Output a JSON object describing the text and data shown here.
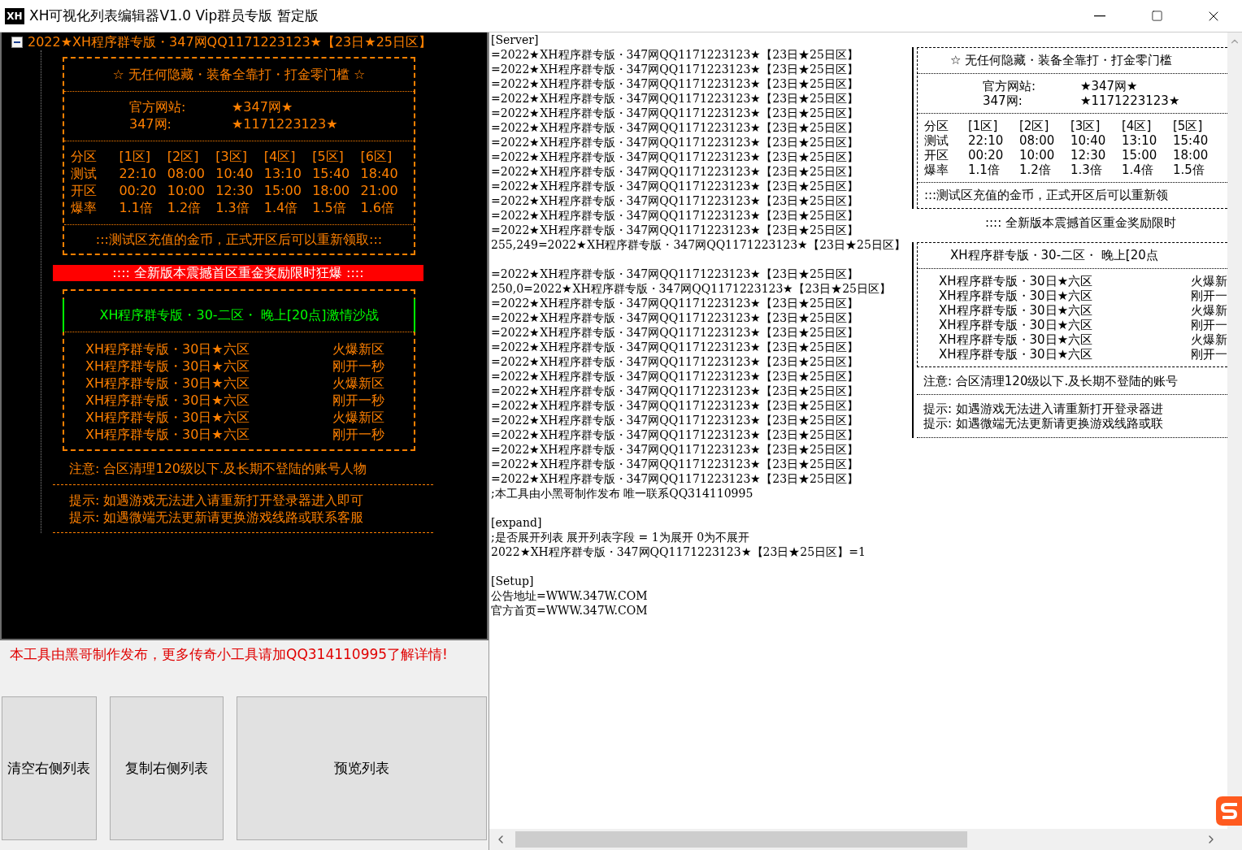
{
  "window": {
    "icon": "XH",
    "title": "XH可视化列表编辑器V1.0 Vip群员专版 暂定版"
  },
  "preview": {
    "root_label": "2022★XH程序群专版・347网QQ1171223123★【23日★25日区】",
    "expanded": true,
    "notice_box": {
      "headline": "☆ 无任何隐藏・装备全靠打・打金零门槛 ☆",
      "contacts": [
        {
          "label": "官方网站:",
          "value": "★347网★"
        },
        {
          "label": "347网:",
          "value": "★1171223123★"
        }
      ],
      "schedule": {
        "columns": [
          "分区",
          "[1区]",
          "[2区]",
          "[3区]",
          "[4区]",
          "[5区]",
          "[6区]"
        ],
        "rows": [
          [
            "测试",
            "22:10",
            "08:00",
            "10:40",
            "13:10",
            "15:40",
            "18:40"
          ],
          [
            "开区",
            "00:20",
            "10:00",
            "12:30",
            "15:00",
            "18:00",
            "21:00"
          ],
          [
            "爆率",
            "1.1倍",
            "1.2倍",
            "1.3倍",
            "1.4倍",
            "1.5倍",
            "1.6倍"
          ]
        ]
      },
      "footer": ":::测试区充值的金币，正式开区后可以重新领取:::"
    },
    "banner": "::::  全新版本震撼首区重金奖励限时狂爆  ::::",
    "server_box": {
      "headline": "XH程序群专版・30-二区・   晚上[20点]激情沙战",
      "servers": [
        {
          "name": "XH程序群专版・30日★六区",
          "status": "火爆新区"
        },
        {
          "name": "XH程序群专版・30日★六区",
          "status": "刚开一秒"
        },
        {
          "name": "XH程序群专版・30日★六区",
          "status": "火爆新区"
        },
        {
          "name": "XH程序群专版・30日★六区",
          "status": "刚开一秒"
        },
        {
          "name": "XH程序群专版・30日★六区",
          "status": "火爆新区"
        },
        {
          "name": "XH程序群专版・30日★六区",
          "status": "刚开一秒"
        }
      ]
    },
    "note": "注意: 合区清理120级以下.及长期不登陆的账号人物",
    "tips": [
      "提示: 如遇游戏无法进入请重新打开登录器进入即可",
      "提示: 如遇微端无法更新请更换游戏线路或联系客服"
    ]
  },
  "credit": "本工具由黑哥制作发布，更多传奇小工具请加QQ314110995了解详情!",
  "buttons": [
    "清空右侧列表",
    "复制右侧列表",
    "预览列表"
  ],
  "editor": {
    "sections": [
      {
        "lines": [
          "[Server]",
          "=2022★XH程序群专版・347网QQ1171223123★【23日★25日区】",
          "=2022★XH程序群专版・347网QQ1171223123★【23日★25日区】",
          "=2022★XH程序群专版・347网QQ1171223123★【23日★25日区】",
          "=2022★XH程序群专版・347网QQ1171223123★【23日★25日区】",
          "=2022★XH程序群专版・347网QQ1171223123★【23日★25日区】",
          "=2022★XH程序群专版・347网QQ1171223123★【23日★25日区】",
          "=2022★XH程序群专版・347网QQ1171223123★【23日★25日区】",
          "=2022★XH程序群专版・347网QQ1171223123★【23日★25日区】",
          "=2022★XH程序群专版・347网QQ1171223123★【23日★25日区】",
          "=2022★XH程序群专版・347网QQ1171223123★【23日★25日区】",
          "=2022★XH程序群专版・347网QQ1171223123★【23日★25日区】",
          "=2022★XH程序群专版・347网QQ1171223123★【23日★25日区】",
          "=2022★XH程序群专版・347网QQ1171223123★【23日★25日区】",
          "255,249=2022★XH程序群专版・347网QQ1171223123★【23日★25日区】"
        ]
      },
      {
        "lines": [
          "=2022★XH程序群专版・347网QQ1171223123★【23日★25日区】",
          "250,0=2022★XH程序群专版・347网QQ1171223123★【23日★25日区】",
          "=2022★XH程序群专版・347网QQ1171223123★【23日★25日区】",
          "=2022★XH程序群专版・347网QQ1171223123★【23日★25日区】",
          "=2022★XH程序群专版・347网QQ1171223123★【23日★25日区】",
          "=2022★XH程序群专版・347网QQ1171223123★【23日★25日区】",
          "=2022★XH程序群专版・347网QQ1171223123★【23日★25日区】",
          "=2022★XH程序群专版・347网QQ1171223123★【23日★25日区】",
          "=2022★XH程序群专版・347网QQ1171223123★【23日★25日区】",
          "=2022★XH程序群专版・347网QQ1171223123★【23日★25日区】",
          "=2022★XH程序群专版・347网QQ1171223123★【23日★25日区】",
          "=2022★XH程序群专版・347网QQ1171223123★【23日★25日区】",
          "=2022★XH程序群专版・347网QQ1171223123★【23日★25日区】",
          "=2022★XH程序群专版・347网QQ1171223123★【23日★25日区】",
          "=2022★XH程序群专版・347网QQ1171223123★【23日★25日区】",
          ";本工具由小黑哥制作发布 唯一联系QQ314110995"
        ]
      },
      {
        "lines": [
          "[expand]",
          ";是否展开列表  展开列表字段 = 1为展开 0为不展开",
          "2022★XH程序群专版・347网QQ1171223123★【23日★25日区】=1"
        ]
      },
      {
        "lines": [
          "[Setup]",
          "公告地址=WWW.347W.COM",
          "官方首页=WWW.347W.COM"
        ]
      }
    ],
    "ghost": {
      "headline": "☆ 无任何隐藏・装备全靠打・打金零门槛",
      "contacts": [
        {
          "label": "官方网站:",
          "value": "★347网★"
        },
        {
          "label": "347网:",
          "value": "★1171223123★"
        }
      ],
      "schedule": {
        "columns": [
          "分区",
          "[1区]",
          "[2区]",
          "[3区]",
          "[4区]",
          "[5区]"
        ],
        "rows": [
          [
            "测试",
            "22:10",
            "08:00",
            "10:40",
            "13:10",
            "15:40"
          ],
          [
            "开区",
            "00:20",
            "10:00",
            "12:30",
            "15:00",
            "18:00"
          ],
          [
            "爆率",
            "1.1倍",
            "1.2倍",
            "1.3倍",
            "1.4倍",
            "1.5倍"
          ]
        ]
      },
      "footer": ":::测试区充值的金币，正式开区后可以重新领",
      "banner": "::::  全新版本震撼首区重金奖励限时",
      "server_headline": "XH程序群专版・30-二区・   晚上[20点",
      "servers": [
        {
          "name": "XH程序群专版・30日★六区",
          "status": "火爆新"
        },
        {
          "name": "XH程序群专版・30日★六区",
          "status": "刚开一"
        },
        {
          "name": "XH程序群专版・30日★六区",
          "status": "火爆新"
        },
        {
          "name": "XH程序群专版・30日★六区",
          "status": "刚开一"
        },
        {
          "name": "XH程序群专版・30日★六区",
          "status": "火爆新"
        },
        {
          "name": "XH程序群专版・30日★六区",
          "status": "刚开一"
        }
      ],
      "note": "注意: 合区清理120级以下.及长期不登陆的账号",
      "tips": [
        "提示: 如遇游戏无法进入请重新打开登录器进",
        "提示: 如遇微端无法更新请更换游戏线路或联"
      ]
    }
  }
}
